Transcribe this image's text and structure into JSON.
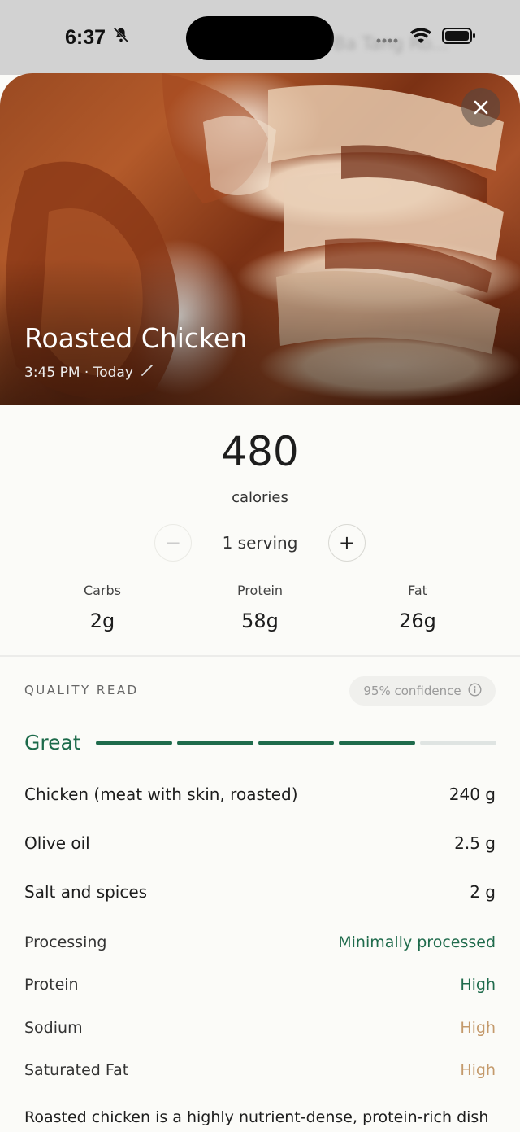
{
  "status_bar": {
    "time": "6:37",
    "blurred_text": "Ba Tang Ro..."
  },
  "hero": {
    "title": "Roasted Chicken",
    "meta": "3:45 PM · Today"
  },
  "calories": {
    "value": "480",
    "label": "calories"
  },
  "serving": {
    "text": "1 serving",
    "minus": "−",
    "plus": "+"
  },
  "macros": [
    {
      "label": "Carbs",
      "value": "2g"
    },
    {
      "label": "Protein",
      "value": "58g"
    },
    {
      "label": "Fat",
      "value": "26g"
    }
  ],
  "quality": {
    "title": "QUALITY READ",
    "confidence": "95% confidence",
    "grade": "Great",
    "grade_level": 4,
    "grade_max": 5
  },
  "ingredients": [
    {
      "name": "Chicken (meat with skin, roasted)",
      "amount": "240 g"
    },
    {
      "name": "Olive oil",
      "amount": "2.5 g"
    },
    {
      "name": "Salt and spices",
      "amount": "2 g"
    }
  ],
  "attributes": [
    {
      "name": "Processing",
      "value": "Minimally processed",
      "tone": "good"
    },
    {
      "name": "Protein",
      "value": "High",
      "tone": "good"
    },
    {
      "name": "Sodium",
      "value": "High",
      "tone": "warn"
    },
    {
      "name": "Saturated Fat",
      "value": "High",
      "tone": "warn"
    }
  ],
  "description": "Roasted chicken is a highly nutrient-dense, protein-rich dish",
  "colors": {
    "accent_green": "#1f6b4c",
    "warn_tan": "#c49a6c"
  }
}
